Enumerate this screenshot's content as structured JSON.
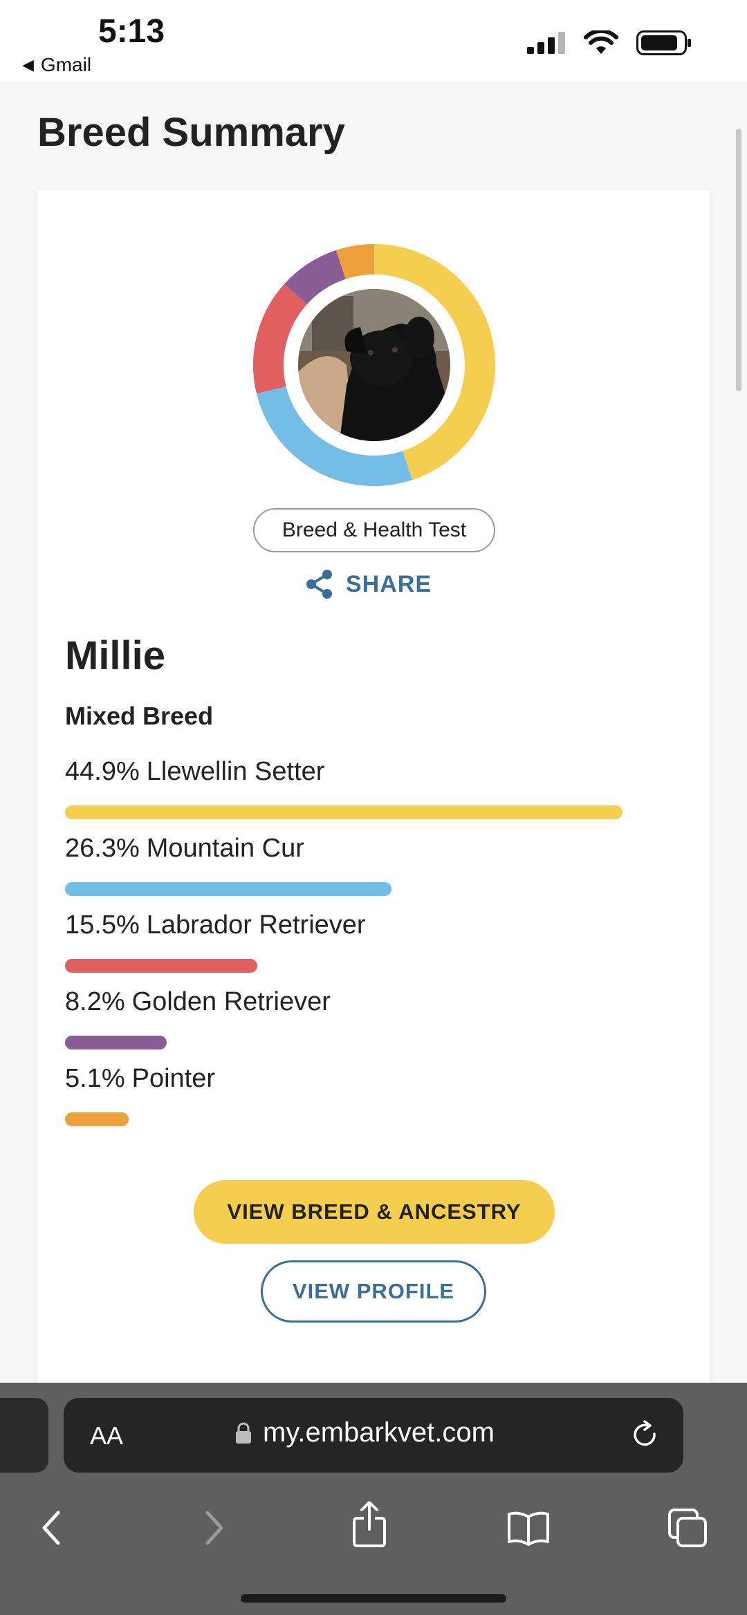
{
  "status_bar": {
    "time": "5:13",
    "back_app": "Gmail",
    "back_icon": "back-triangle-icon",
    "icons": [
      "cellular-signal-icon",
      "wifi-icon",
      "battery-icon"
    ]
  },
  "page": {
    "title": "Breed Summary"
  },
  "card": {
    "test_type": "Breed & Health Test",
    "share_label": "SHARE",
    "dog_name": "Millie",
    "mix_label": "Mixed Breed",
    "breeds": [
      {
        "percent": "44.9%",
        "name": "Llewellin Setter",
        "value": 44.9,
        "color": "#f6ce4f"
      },
      {
        "percent": "26.3%",
        "name": "Mountain Cur",
        "value": 26.3,
        "color": "#74bde6"
      },
      {
        "percent": "15.5%",
        "name": "Labrador Retriever",
        "value": 15.5,
        "color": "#e0605f"
      },
      {
        "percent": "8.2%",
        "name": "Golden Retriever",
        "value": 8.2,
        "color": "#8a5c96"
      },
      {
        "percent": "5.1%",
        "name": "Pointer",
        "value": 5.1,
        "color": "#eea03c"
      }
    ],
    "primary_button": "VIEW BREED & ANCESTRY",
    "secondary_button": "VIEW PROFILE"
  },
  "browser": {
    "text_size_button": "AA",
    "url": "my.embarkvet.com",
    "lock_icon": "lock-icon",
    "reload_icon": "reload-icon",
    "toolbar_icons": [
      "back-chevron-icon",
      "forward-chevron-icon",
      "share-icon",
      "bookmarks-icon",
      "tabs-icon"
    ]
  },
  "colors": {
    "accent_blue": "#3b6f99",
    "primary_yellow": "#f6ce4f"
  }
}
